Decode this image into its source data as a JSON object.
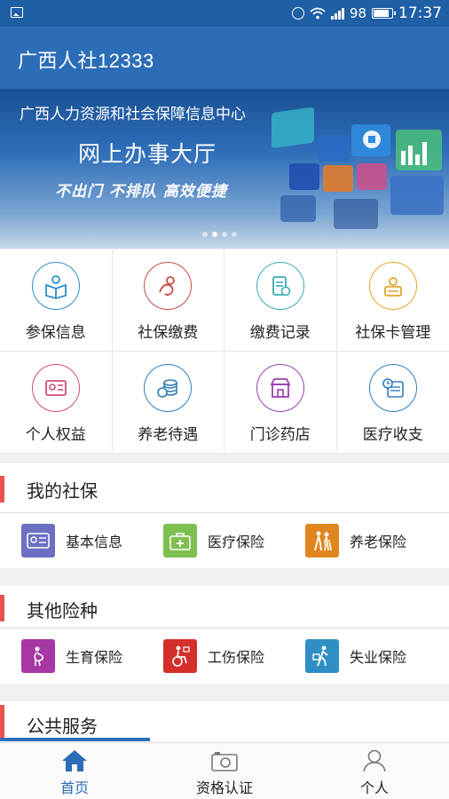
{
  "status_bar": {
    "battery": "98",
    "time": "17:37"
  },
  "app_bar": {
    "title": "广西人社12333"
  },
  "banner": {
    "org": "广西人力资源和社会保障信息中心",
    "headline": "网上办事大厅",
    "slogan": "不出门 不排队 高效便捷",
    "active_dot": 1,
    "dot_count": 4
  },
  "grid": [
    {
      "label": "参保信息",
      "icon": "book-reader-icon",
      "color": "#2e8ec9"
    },
    {
      "label": "社保缴费",
      "icon": "hand-coin-icon",
      "color": "#c94a43"
    },
    {
      "label": "缴费记录",
      "icon": "receipt-icon",
      "color": "#3aa9b5"
    },
    {
      "label": "社保卡管理",
      "icon": "card-person-icon",
      "color": "#e2a62b"
    },
    {
      "label": "个人权益",
      "icon": "id-card-icon",
      "color": "#d24a7a"
    },
    {
      "label": "养老待遇",
      "icon": "coin-stack-icon",
      "color": "#2e7fb8"
    },
    {
      "label": "门诊药店",
      "icon": "store-icon",
      "color": "#9b3fb0"
    },
    {
      "label": "医疗收支",
      "icon": "calendar-clock-icon",
      "color": "#2e7fb8"
    }
  ],
  "sections": [
    {
      "title": "我的社保",
      "items": [
        {
          "label": "基本信息",
          "icon": "id-card-icon",
          "color": "#6d6fc2"
        },
        {
          "label": "医疗保险",
          "icon": "medical-kit-icon",
          "color": "#7dc04f"
        },
        {
          "label": "养老保险",
          "icon": "elderly-couple-icon",
          "color": "#e0861f"
        }
      ]
    },
    {
      "title": "其他险种",
      "items": [
        {
          "label": "生育保险",
          "icon": "pregnant-icon",
          "color": "#a637a4"
        },
        {
          "label": "工伤保险",
          "icon": "wheelchair-icon",
          "color": "#d42f2a"
        },
        {
          "label": "失业保险",
          "icon": "walking-briefcase-icon",
          "color": "#2f8fc4"
        }
      ]
    },
    {
      "title": "公共服务",
      "items": []
    }
  ],
  "bottom_nav": [
    {
      "label": "首页",
      "icon": "home-icon",
      "active": true
    },
    {
      "label": "资格认证",
      "icon": "camera-icon",
      "active": false
    },
    {
      "label": "个人",
      "icon": "person-icon",
      "active": false
    }
  ],
  "colors": {
    "status_bar": "#1e5fa6",
    "app_bar": "#2c6db8",
    "accent_red": "#e9534f",
    "active_nav": "#2c6db8"
  }
}
